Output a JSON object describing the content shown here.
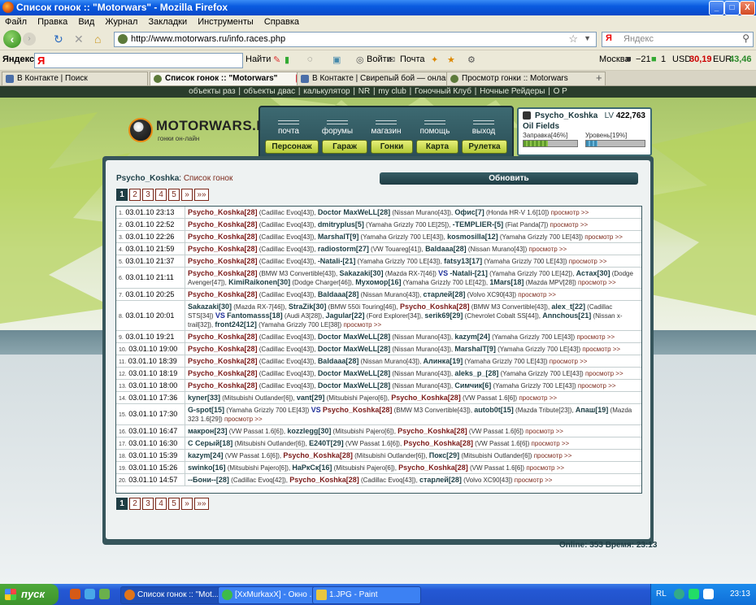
{
  "window": {
    "title": "Список гонок :: \"Motorwars\" - Mozilla Firefox",
    "buttons": [
      "_",
      "□",
      "X"
    ]
  },
  "menu": [
    "Файл",
    "Правка",
    "Вид",
    "Журнал",
    "Закладки",
    "Инструменты",
    "Справка"
  ],
  "address_bar": {
    "url": "http://www.motorwars.ru/info.races.php"
  },
  "search_bar": {
    "placeholder": "Яндекс"
  },
  "yandex_bar": {
    "label": "Яндекс",
    "find": "Найти",
    "login": "Войти",
    "mail": "Почта",
    "city": "Москва",
    "temp": "−21",
    "mail_count": "1",
    "usd_label": "USD",
    "usd": "30,19",
    "eur_label": "EUR",
    "eur": "43,46"
  },
  "tabs": [
    {
      "label": "В Контакте | Поиск",
      "active": false
    },
    {
      "label": "Список гонок :: \"Motorwars\"",
      "active": true
    },
    {
      "label": "В Контакте | Свирепый бой — онлай...",
      "active": false
    },
    {
      "label": "Просмотр гонки :: Motorwars",
      "active": false
    }
  ],
  "top_links": [
    "объекты раз",
    "объекты двас",
    "калькулятор",
    "NR",
    "my club",
    "Гоночный Клуб",
    "Ночные Рейдеры",
    "О Р"
  ],
  "site": {
    "logo": "MOTORWARS.RU",
    "tagline": "гонки он-лайн",
    "nav_top": [
      "почта",
      "форумы",
      "магазин",
      "помощь",
      "выход"
    ],
    "nav_bottom": [
      "Персонаж",
      "Гараж",
      "Гонки",
      "Карта",
      "Рулетка"
    ]
  },
  "user": {
    "name": "Psycho_Koshka",
    "level_label": "LV",
    "level": "422,763",
    "club": "Oil Fields",
    "fuel_label": "Заправка[46%]",
    "fuel": 0.46,
    "level_progress_label": "Уровень[19%]",
    "level_progress": 0.19
  },
  "races_page": {
    "user": "Psycho_Koshka",
    "separator": ":",
    "title": "Список гонок",
    "refresh_button": "Обновить",
    "pages": [
      "1",
      "2",
      "3",
      "4",
      "5",
      "»",
      "»»"
    ],
    "current_page": "1",
    "view_link": "просмотр >>",
    "vs_label": "VS",
    "races": [
      {
        "n": "1.",
        "date": "03.01.10 23:13",
        "rows": 1,
        "parts": [
          {
            "p": "Psycho_Koshka[28]",
            "c": "(Cadillac Evoq[43])"
          },
          {
            "p": "Doctor MaxWeLL[28]",
            "c": "(Nissan Murano[43])"
          },
          {
            "p": "Офис[7]",
            "c": "(Honda HR-V 1.6[10])"
          }
        ]
      },
      {
        "n": "2.",
        "date": "03.01.10 22:52",
        "rows": 1,
        "parts": [
          {
            "p": "Psycho_Koshka[28]",
            "c": "(Cadillac Evoq[43])"
          },
          {
            "p": "dmitryplus[5]",
            "c": "(Yamaha Grizzly 700 LE[25])"
          },
          {
            "p": "-TEMPLIER-[5]",
            "c": "(Fiat Panda[7])"
          }
        ]
      },
      {
        "n": "3.",
        "date": "03.01.10 22:26",
        "rows": 1,
        "parts": [
          {
            "p": "Psycho_Koshka[28]",
            "c": "(Cadillac Evoq[43])"
          },
          {
            "p": "MarshalT[9]",
            "c": "(Yamaha Grizzly 700 LE[43])"
          },
          {
            "p": "kosmosilla[12]",
            "c": "(Yamaha Grizzly 700 LE[43])"
          }
        ]
      },
      {
        "n": "4.",
        "date": "03.01.10 21:59",
        "rows": 1,
        "parts": [
          {
            "p": "Psycho_Koshka[28]",
            "c": "(Cadillac Evoq[43])"
          },
          {
            "p": "radiostorm[27]",
            "c": "(VW Touareg[41])"
          },
          {
            "p": "Baldaaa[28]",
            "c": "(Nissan Murano[43])"
          }
        ]
      },
      {
        "n": "5.",
        "date": "03.01.10 21:37",
        "rows": 1,
        "parts": [
          {
            "p": "Psycho_Koshka[28]",
            "c": "(Cadillac Evoq[43])"
          },
          {
            "p": "-Natali-[21]",
            "c": "(Yamaha Grizzly 700 LE[43])"
          },
          {
            "p": "fatsy13[17]",
            "c": "(Yamaha Grizzly 700 LE[43])"
          }
        ]
      },
      {
        "n": "6.",
        "date": "03.01.10 21:11",
        "rows": 2,
        "vs_after": 2,
        "parts": [
          {
            "p": "Psycho_Koshka[28]",
            "c": "(BMW M3 Convertible[43])"
          },
          {
            "p": "Sakazaki[30]",
            "c": "(Mazda RX-7[46])"
          },
          {
            "p": "-Natali-[21]",
            "c": "(Yamaha Grizzly 700 LE[42])"
          },
          {
            "p": "Астах[30]",
            "c": "(Dodge Avenger[47])"
          },
          {
            "p": "KimiRaikonen[30]",
            "c": "(Dodge Charger[46])"
          },
          {
            "p": "Мухомор[16]",
            "c": "(Yamaha Grizzly 700 LE[42])"
          },
          {
            "p": "1Mars[18]",
            "c": "(Mazda MPV[28])"
          }
        ]
      },
      {
        "n": "7.",
        "date": "03.01.10 20:25",
        "rows": 1,
        "parts": [
          {
            "p": "Psycho_Koshka[28]",
            "c": "(Cadillac Evoq[43])"
          },
          {
            "p": "Baldaaa[28]",
            "c": "(Nissan Murano[43])"
          },
          {
            "p": "старлей[28]",
            "c": "(Volvo XC90[43])"
          }
        ]
      },
      {
        "n": "8.",
        "date": "03.01.10 20:01",
        "rows": 3,
        "vs_after": 4,
        "parts": [
          {
            "p": "Sakazaki[30]",
            "c": "(Mazda RX-7[46])"
          },
          {
            "p": "StraZik[30]",
            "c": "(BMW 550i Touring[46])"
          },
          {
            "p": "Psycho_Koshka[28]",
            "c": "(BMW M3 Convertible[43])"
          },
          {
            "p": "alex_t[22]",
            "c": "(Cadillac STS[34])"
          },
          {
            "p": "Fantomasss[18]",
            "c": "(Audi A3[28])"
          },
          {
            "p": "Jagular[22]",
            "c": "(Ford Explorer[34])"
          },
          {
            "p": "serik69[29]",
            "c": "(Chevrolet Cobalt SS[44])"
          },
          {
            "p": "Annchous[21]",
            "c": "(Nissan x-trail[32])"
          },
          {
            "p": "front242[12]",
            "c": "(Yamaha Grizzly 700 LE[38])"
          }
        ]
      },
      {
        "n": "9.",
        "date": "03.01.10 19:21",
        "rows": 1,
        "parts": [
          {
            "p": "Psycho_Koshka[28]",
            "c": "(Cadillac Evoq[43])"
          },
          {
            "p": "Doctor MaxWeLL[28]",
            "c": "(Nissan Murano[43])"
          },
          {
            "p": "kazym[24]",
            "c": "(Yamaha Grizzly 700 LE[43])"
          }
        ]
      },
      {
        "n": "10.",
        "date": "03.01.10 19:00",
        "rows": 1,
        "parts": [
          {
            "p": "Psycho_Koshka[28]",
            "c": "(Cadillac Evoq[43])"
          },
          {
            "p": "Doctor MaxWeLL[28]",
            "c": "(Nissan Murano[43])"
          },
          {
            "p": "MarshalT[9]",
            "c": "(Yamaha Grizzly 700 LE[43])"
          }
        ]
      },
      {
        "n": "11.",
        "date": "03.01.10 18:39",
        "rows": 1,
        "parts": [
          {
            "p": "Psycho_Koshka[28]",
            "c": "(Cadillac Evoq[43])"
          },
          {
            "p": "Baldaaa[28]",
            "c": "(Nissan Murano[43])"
          },
          {
            "p": "Алинка[19]",
            "c": "(Yamaha Grizzly 700 LE[43])"
          }
        ]
      },
      {
        "n": "12.",
        "date": "03.01.10 18:19",
        "rows": 1,
        "parts": [
          {
            "p": "Psycho_Koshka[28]",
            "c": "(Cadillac Evoq[43])"
          },
          {
            "p": "Doctor MaxWeLL[28]",
            "c": "(Nissan Murano[43])"
          },
          {
            "p": "aleks_p_[28]",
            "c": "(Yamaha Grizzly 700 LE[43])"
          }
        ]
      },
      {
        "n": "13.",
        "date": "03.01.10 18:00",
        "rows": 1,
        "parts": [
          {
            "p": "Psycho_Koshka[28]",
            "c": "(Cadillac Evoq[43])"
          },
          {
            "p": "Doctor MaxWeLL[28]",
            "c": "(Nissan Murano[43])"
          },
          {
            "p": "Симчик[6]",
            "c": "(Yamaha Grizzly 700 LE[43])"
          }
        ]
      },
      {
        "n": "14.",
        "date": "03.01.10 17:36",
        "rows": 1,
        "parts": [
          {
            "p": "kyner[33]",
            "c": "(Mitsubishi Outlander[6])"
          },
          {
            "p": "vant[29]",
            "c": "(Mitsubishi Pajero[6])"
          },
          {
            "p": "Psycho_Koshka[28]",
            "c": "(VW Passat 1.6[6])"
          }
        ]
      },
      {
        "n": "15.",
        "date": "03.01.10 17:30",
        "rows": 2,
        "vs_after": 1,
        "parts": [
          {
            "p": "G-spot[15]",
            "c": "(Yamaha Grizzly 700 LE[43])"
          },
          {
            "p": "Psycho_Koshka[28]",
            "c": "(BMW M3 Convertible[43])"
          },
          {
            "p": "autob0t[15]",
            "c": "(Mazda Tribute[23])"
          },
          {
            "p": "Апаш[19]",
            "c": "(Mazda 323 1.6[29])"
          }
        ]
      },
      {
        "n": "16.",
        "date": "03.01.10 16:47",
        "rows": 1,
        "parts": [
          {
            "p": "макрон[23]",
            "c": "(VW Passat 1.6[6])"
          },
          {
            "p": "kozzlegg[30]",
            "c": "(Mitsubishi Pajero[6])"
          },
          {
            "p": "Psycho_Koshka[28]",
            "c": "(VW Passat 1.6[6])"
          }
        ]
      },
      {
        "n": "17.",
        "date": "03.01.10 16:30",
        "rows": 1,
        "parts": [
          {
            "p": "С Серый[18]",
            "c": "(Mitsubishi Outlander[6])"
          },
          {
            "p": "E240T[29]",
            "c": "(VW Passat 1.6[6])"
          },
          {
            "p": "Psycho_Koshka[28]",
            "c": "(VW Passat 1.6[6])"
          }
        ]
      },
      {
        "n": "18.",
        "date": "03.01.10 15:39",
        "rows": 1,
        "parts": [
          {
            "p": "kazym[24]",
            "c": "(VW Passat 1.6[6])"
          },
          {
            "p": "Psycho_Koshka[28]",
            "c": "(Mitsubishi Outlander[6])"
          },
          {
            "p": "Покс[29]",
            "c": "(Mitsubishi Outlander[6])"
          }
        ]
      },
      {
        "n": "19.",
        "date": "03.01.10 15:26",
        "rows": 1,
        "parts": [
          {
            "p": "swinko[16]",
            "c": "(Mitsubishi Pajero[6])"
          },
          {
            "p": "НаРкСк[16]",
            "c": "(Mitsubishi Pajero[6])"
          },
          {
            "p": "Psycho_Koshka[28]",
            "c": "(VW Passat 1.6[6])"
          }
        ]
      },
      {
        "n": "20.",
        "date": "03.01.10 14:57",
        "rows": 1,
        "parts": [
          {
            "p": "--Бони--[28]",
            "c": "(Cadillac Evoq[42])"
          },
          {
            "p": "Psycho_Koshka[28]",
            "c": "(Cadillac Evoq[43])"
          },
          {
            "p": "старлей[28]",
            "c": "(Volvo XC90[43])"
          }
        ]
      }
    ]
  },
  "status": {
    "online_label": "Online:",
    "online": "353",
    "time_label": "Время:",
    "time": "23:13"
  },
  "taskbar": {
    "start": "пуск",
    "tasks": [
      "Список гонок :: \"Mot...",
      "[XxMurkaxX] - Окно ...",
      "1.JPG - Paint"
    ],
    "lang": "RL",
    "clock": "23:13"
  },
  "colors": {
    "accent": "#36555b",
    "link": "#7c2a1c",
    "button": "#c6d844"
  }
}
